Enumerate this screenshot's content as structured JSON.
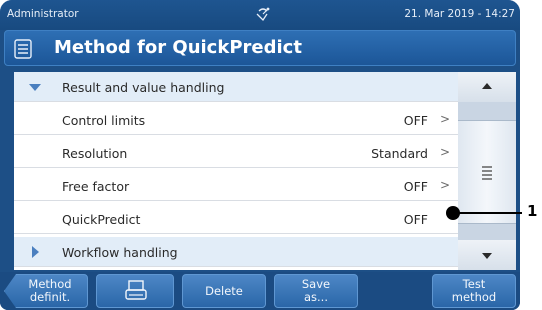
{
  "status_bar": {
    "user": "Administrator",
    "icon": "satellite-dish-icon",
    "datetime": "21. Mar 2019 - 14:27"
  },
  "title_bar": {
    "icon": "method-list-icon",
    "title": "Method for QuickPredict"
  },
  "list": {
    "rows": [
      {
        "type": "group",
        "label": "Result and value handling",
        "expanded": true
      },
      {
        "type": "item",
        "label": "Control limits",
        "value": "OFF",
        "chevron": ">"
      },
      {
        "type": "item",
        "label": "Resolution",
        "value": "Standard",
        "chevron": ">"
      },
      {
        "type": "item",
        "label": "Free factor",
        "value": "OFF",
        "chevron": ">"
      },
      {
        "type": "item",
        "label": "QuickPredict",
        "value": "OFF",
        "chevron": ""
      },
      {
        "type": "group",
        "label": "Workflow handling",
        "expanded": false
      }
    ]
  },
  "bottom_bar": {
    "method_definit": [
      "Method",
      "definit."
    ],
    "print_icon": "printer-icon",
    "delete": "Delete",
    "save_as": [
      "Save",
      "as..."
    ],
    "test_method": [
      "Test",
      "method"
    ]
  },
  "callout": {
    "number": "1"
  },
  "colors": {
    "frame": "#1d4f86",
    "button": "#3b77b8",
    "group_row": "#e2edf8"
  }
}
